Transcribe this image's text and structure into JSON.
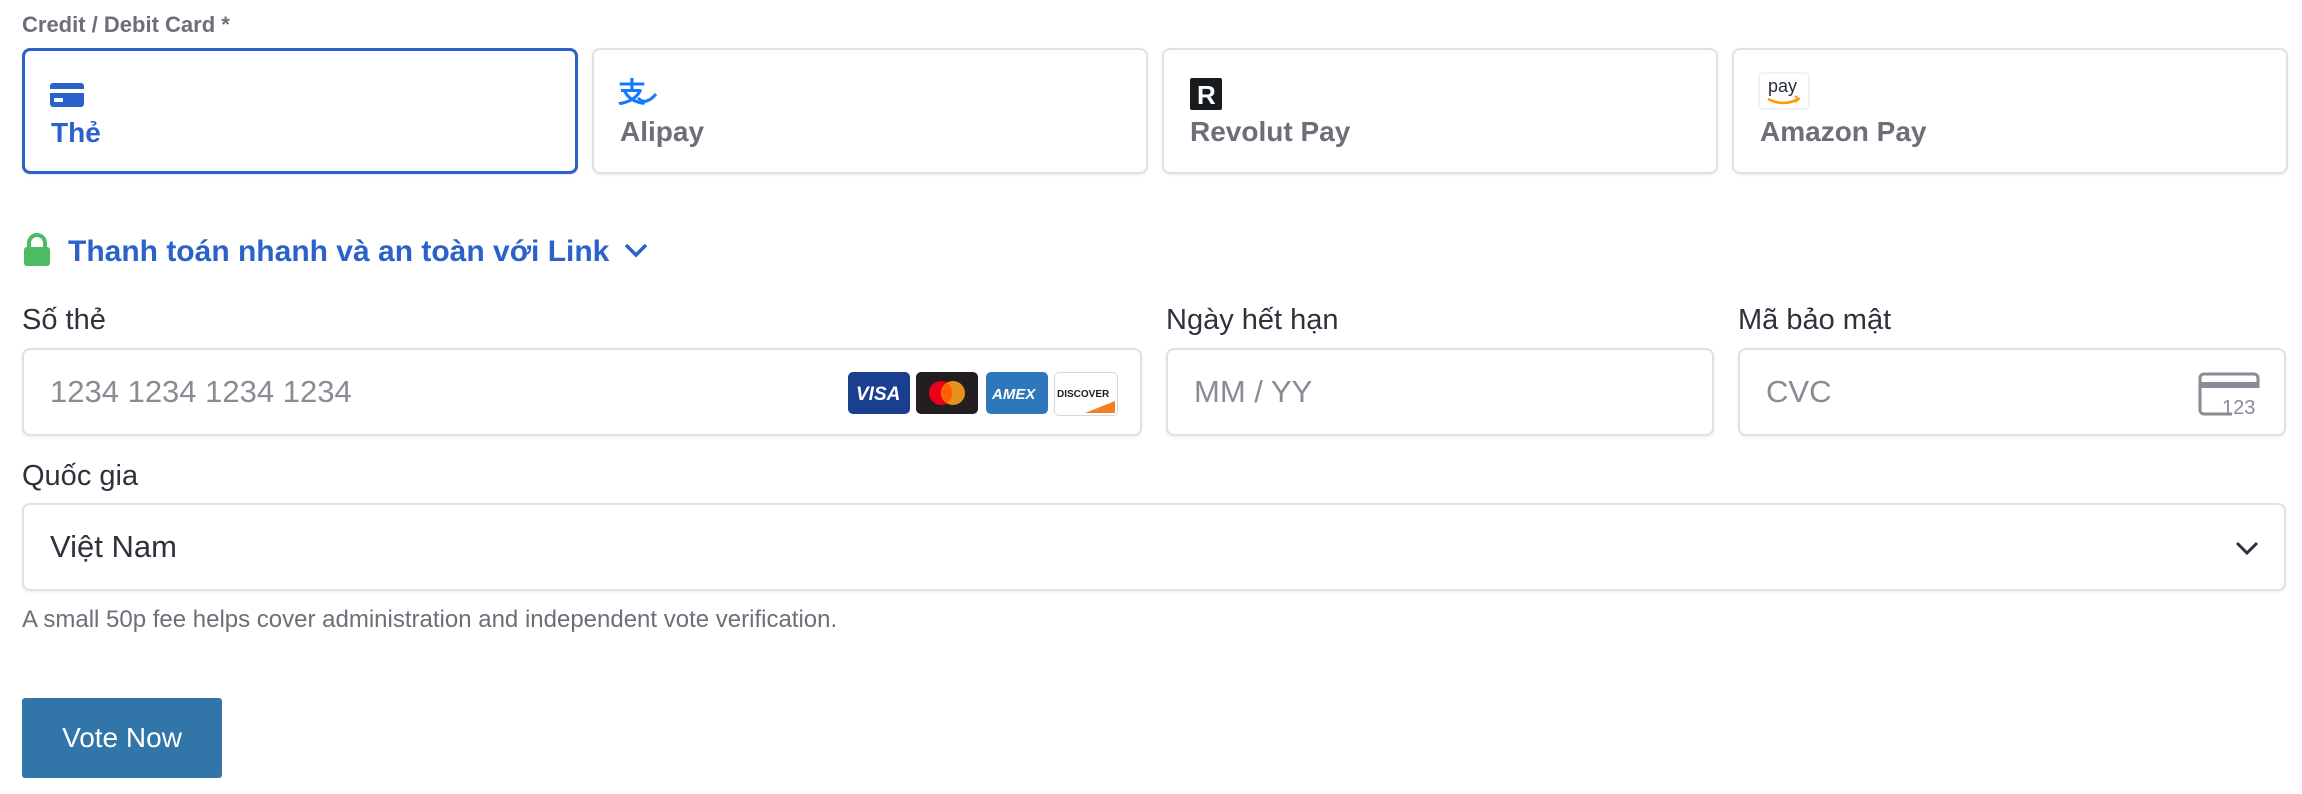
{
  "section_label": "Credit / Debit Card *",
  "methods": [
    {
      "label": "Thẻ",
      "icon": "credit-card-icon",
      "selected": true
    },
    {
      "label": "Alipay",
      "icon": "alipay-icon",
      "selected": false
    },
    {
      "label": "Revolut Pay",
      "icon": "revolut-icon",
      "selected": false
    },
    {
      "label": "Amazon Pay",
      "icon": "amazon-pay-icon",
      "icon_text": "pay",
      "selected": false
    }
  ],
  "link": {
    "text": "Thanh toán nhanh và an toàn với Link",
    "icon": "lock-icon",
    "chevron": "chevron-down-icon"
  },
  "card_number": {
    "label": "Số thẻ",
    "placeholder": "1234 1234 1234 1234",
    "brands": [
      {
        "name": "visa-logo",
        "text": "VISA",
        "color": "#1a3f8f"
      },
      {
        "name": "mastercard-logo",
        "color": "#231f20"
      },
      {
        "name": "amex-logo",
        "text": "AMEX",
        "color": "#2e77bc"
      },
      {
        "name": "discover-logo",
        "text": "DISCOVER",
        "color": "#ffffff"
      }
    ]
  },
  "expiry": {
    "label": "Ngày hết hạn",
    "placeholder": "MM / YY"
  },
  "cvc": {
    "label": "Mã bảo mật",
    "placeholder": "CVC",
    "icon_text": "123"
  },
  "country": {
    "label": "Quốc gia",
    "value": "Việt Nam"
  },
  "note": "A small 50p fee helps cover administration and independent vote verification.",
  "vote_button": "Vote Now",
  "colors": {
    "accent": "#2a62c9",
    "lock": "#4cbb63",
    "button": "#3275a8",
    "muted": "#6d6e78"
  }
}
